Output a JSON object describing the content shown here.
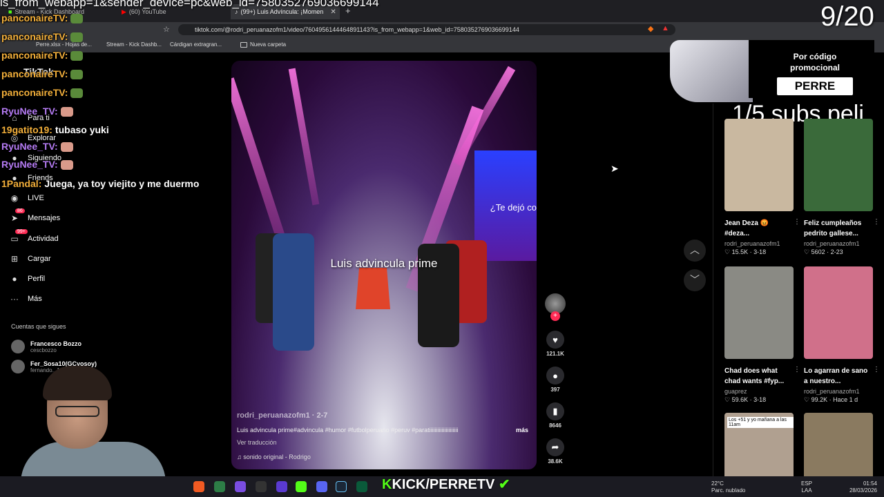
{
  "browser": {
    "tabs": [
      {
        "label": "Stream - Kick Dashboard"
      },
      {
        "label": "(60) YouTube"
      },
      {
        "label": "(99+) Luis Advíncula: ¡Momen"
      }
    ],
    "url": "tiktok.com/@rodri_peruanazofm1/video/7604956144464891143?is_from_webapp=1&web_id=7580352769036699144",
    "bookmarks": [
      "Perre.xlsx - Hojas de...",
      "Stream - Kick Dashb...",
      "Cárdigan extragran...",
      "Nueva carpeta"
    ]
  },
  "overlay": {
    "url_text": "is_from_webapp=1&sender_device=pc&web_id=7580352769036699144",
    "counter": "9/20",
    "subs": "1/5 subs peli",
    "kick_handle": "KICK/PERRETV"
  },
  "chat": [
    {
      "user": "panconaireTV:",
      "msg": "",
      "color": "#f4b03a"
    },
    {
      "user": "panconaireTV:",
      "msg": "",
      "color": "#f4b03a"
    },
    {
      "user": "panconaireTV:",
      "msg": "",
      "color": "#f4b03a"
    },
    {
      "user": "panconaireTV:",
      "msg": "",
      "color": "#f4b03a"
    },
    {
      "user": "panconaireTV:",
      "msg": "",
      "color": "#f4b03a"
    },
    {
      "user": "RyuNee_TV:",
      "msg": "",
      "color": "#b67cf5"
    },
    {
      "user": "19gatito19:",
      "msg": "tubaso yuki",
      "color": "#f4b03a"
    },
    {
      "user": "RyuNee_TV:",
      "msg": "",
      "color": "#b67cf5"
    },
    {
      "user": "RyuNee_TV:",
      "msg": "",
      "color": "#b67cf5"
    },
    {
      "user": "1Pandal:",
      "msg": "Juega, ya toy viejito y me duermo",
      "color": "#f4b03a"
    }
  ],
  "tiktok": {
    "logo": "TikTok",
    "nav": {
      "para_ti": "Para ti",
      "explorar": "Explorar",
      "siguiendo": "Siguiendo",
      "friends": "Friends",
      "live": "LIVE",
      "mensajes": "Mensajes",
      "mensajes_badge": "86",
      "actividad": "Actividad",
      "actividad_badge": "99+",
      "cargar": "Cargar",
      "perfil": "Perfil",
      "mas": "Más"
    },
    "following_title": "Cuentas que sigues",
    "following": [
      {
        "name": "Francesco Bozzo",
        "handle": "cescbozzo"
      },
      {
        "name": "Fer_Sosa10(GCyosoy)",
        "handle": "fernando...10"
      }
    ]
  },
  "video": {
    "caption": "Luis advincula prime",
    "screen_text": "¿Te dejó co",
    "username": "rodri_peruanazofm1 · 2-7",
    "description": "Luis advincula prime#advincula #humor #futbolperuano #peruv #paratiiiiiiiiiiiiiiiiiiiii",
    "more": "más",
    "translate": "Ver traducción",
    "sound": "sonido original - Rodrigo"
  },
  "actions": {
    "likes": "121.1K",
    "comments": "397",
    "saves": "8646",
    "shares": "38.6K"
  },
  "promo": {
    "text": "Por código promocional",
    "code": "PERRE"
  },
  "grid": [
    {
      "title": "Jean Deza 😡 #deza...",
      "author": "rodri_peruanazofm1",
      "meta": "♡ 15.5K · 3-18",
      "color": "#c9b8a0"
    },
    {
      "title": "Feliz cumpleaños pedrito gallese...",
      "author": "rodri_peruanazofm1",
      "meta": "♡ 5602 · 2-23",
      "color": "#3a6a3a"
    },
    {
      "title": "Chad does what chad wants #fyp...",
      "author": "guaprez",
      "meta": "♡ 59.6K · 3-18",
      "color": "#8a8a84"
    },
    {
      "title": "Lo agarran de sano a nuestro...",
      "author": "rodri_peruanazofm1",
      "meta": "♡ 99.2K · Hace 1 d",
      "color": "#d0708a"
    },
    {
      "title": "Los +51 y yo mañana a las 11am",
      "author": "",
      "meta": "",
      "color": "#b0a090"
    },
    {
      "title": "",
      "author": "",
      "meta": "",
      "color": "#8a7a60"
    }
  ],
  "taskbar": {
    "weather_temp": "22°C",
    "weather_desc": "Parc. nublado",
    "lang1": "ESP",
    "lang2": "LAA",
    "time": "01:54",
    "date": "28/03/2026"
  }
}
